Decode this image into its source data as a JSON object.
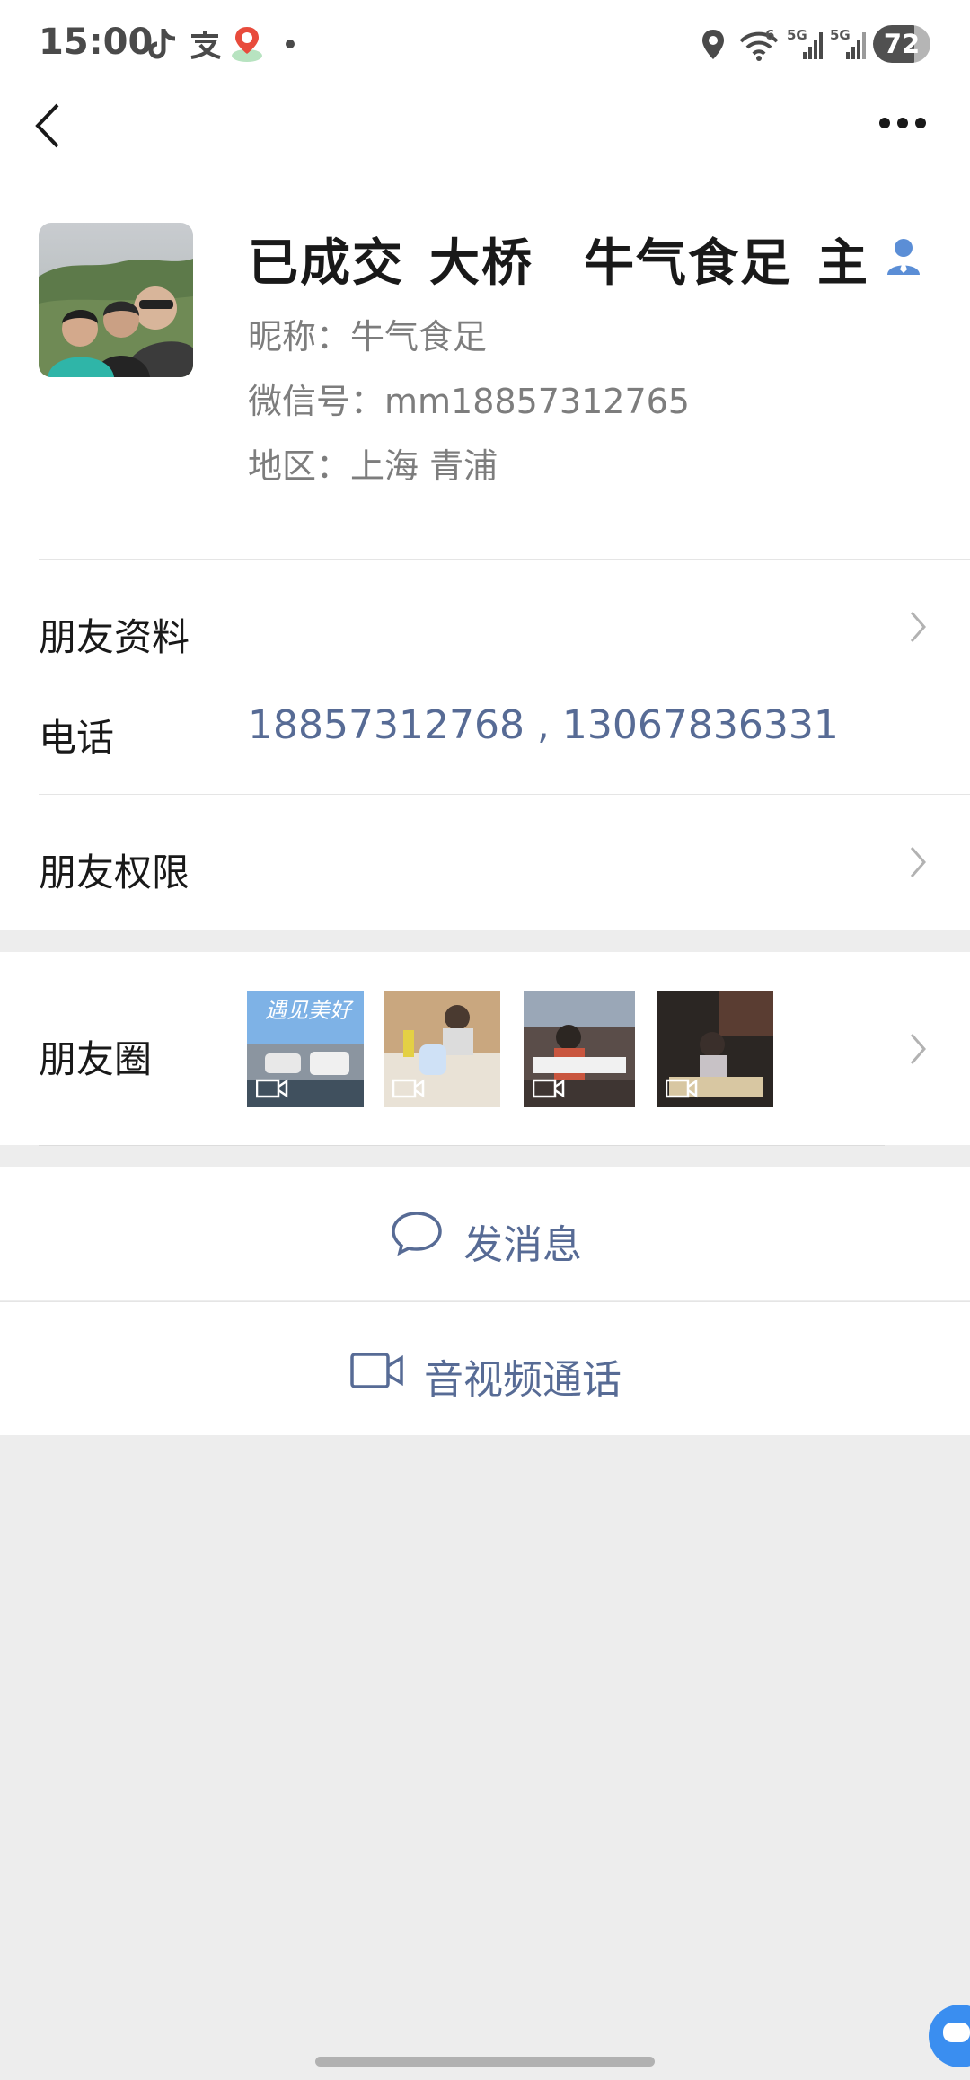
{
  "status_bar": {
    "time": "15:00",
    "battery": "72",
    "network_1": "5G",
    "network_2": "5G",
    "wifi_badge": "6",
    "notif_icons": [
      "tiktok-icon",
      "alipay-icon",
      "map-du-icon",
      "dot-icon"
    ],
    "right_icons": [
      "location-icon",
      "wifi-icon",
      "signal-icon",
      "signal-icon"
    ]
  },
  "nav": {
    "back_icon": "chevron-left-icon",
    "more_icon": "more-dots-icon"
  },
  "profile": {
    "name_part1": "已成交",
    "name_part2": "大桥",
    "name_part3": "牛气食足",
    "name_part4": "主",
    "nickname": "昵称：牛气食足",
    "wechat_id": "微信号：mm18857312765",
    "region": "地区：上海  青浦",
    "contact_icon": "person-icon"
  },
  "rows": {
    "friend_info": "朋友资料",
    "phone_label": "电话",
    "phone_numbers": "18857312768 , 13067836331",
    "friend_permissions": "朋友权限",
    "moments": "朋友圈",
    "moments_thumb1_text": "遇见美好"
  },
  "actions": {
    "send_message": "发消息",
    "video_call": "音视频通话"
  },
  "colors": {
    "link": "#576b95",
    "background": "#ededed",
    "white": "#ffffff"
  }
}
